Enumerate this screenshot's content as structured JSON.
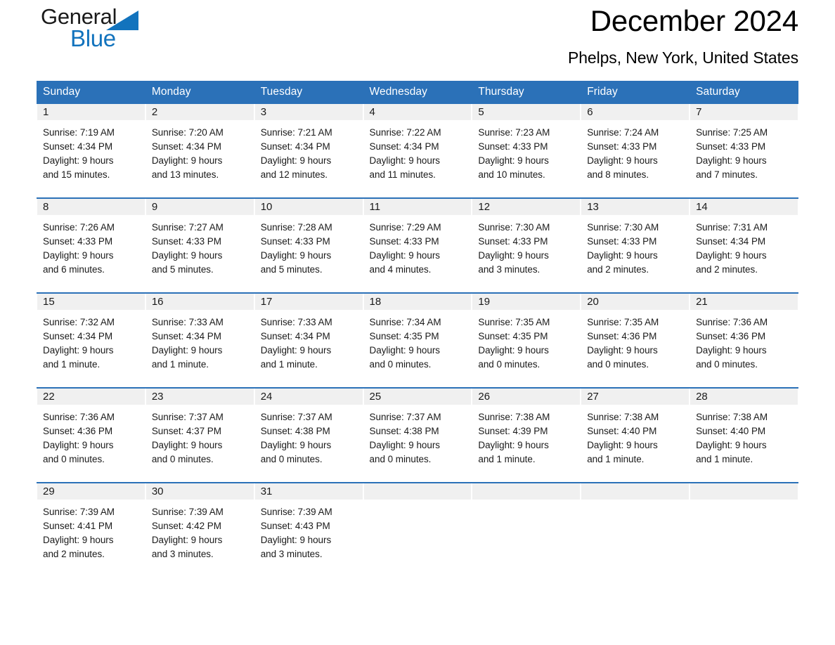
{
  "logo": {
    "word_one": "General",
    "word_two": "Blue",
    "triangle_color": "#1273bd",
    "text_color": "#1a1a1a"
  },
  "header": {
    "title": "December 2024",
    "subtitle": "Phelps, New York, United States"
  },
  "theme": {
    "header_blue": "#2b71b8",
    "daynum_strip": "#f0f0f0",
    "text": "#1a1a1a",
    "page_background": "#ffffff"
  },
  "calendar": {
    "day_headers": [
      "Sunday",
      "Monday",
      "Tuesday",
      "Wednesday",
      "Thursday",
      "Friday",
      "Saturday"
    ],
    "weeks": [
      [
        {
          "day": "1",
          "sunrise": "Sunrise: 7:19 AM",
          "sunset": "Sunset: 4:34 PM",
          "daylight_line1": "Daylight: 9 hours",
          "daylight_line2": "and 15 minutes."
        },
        {
          "day": "2",
          "sunrise": "Sunrise: 7:20 AM",
          "sunset": "Sunset: 4:34 PM",
          "daylight_line1": "Daylight: 9 hours",
          "daylight_line2": "and 13 minutes."
        },
        {
          "day": "3",
          "sunrise": "Sunrise: 7:21 AM",
          "sunset": "Sunset: 4:34 PM",
          "daylight_line1": "Daylight: 9 hours",
          "daylight_line2": "and 12 minutes."
        },
        {
          "day": "4",
          "sunrise": "Sunrise: 7:22 AM",
          "sunset": "Sunset: 4:34 PM",
          "daylight_line1": "Daylight: 9 hours",
          "daylight_line2": "and 11 minutes."
        },
        {
          "day": "5",
          "sunrise": "Sunrise: 7:23 AM",
          "sunset": "Sunset: 4:33 PM",
          "daylight_line1": "Daylight: 9 hours",
          "daylight_line2": "and 10 minutes."
        },
        {
          "day": "6",
          "sunrise": "Sunrise: 7:24 AM",
          "sunset": "Sunset: 4:33 PM",
          "daylight_line1": "Daylight: 9 hours",
          "daylight_line2": "and 8 minutes."
        },
        {
          "day": "7",
          "sunrise": "Sunrise: 7:25 AM",
          "sunset": "Sunset: 4:33 PM",
          "daylight_line1": "Daylight: 9 hours",
          "daylight_line2": "and 7 minutes."
        }
      ],
      [
        {
          "day": "8",
          "sunrise": "Sunrise: 7:26 AM",
          "sunset": "Sunset: 4:33 PM",
          "daylight_line1": "Daylight: 9 hours",
          "daylight_line2": "and 6 minutes."
        },
        {
          "day": "9",
          "sunrise": "Sunrise: 7:27 AM",
          "sunset": "Sunset: 4:33 PM",
          "daylight_line1": "Daylight: 9 hours",
          "daylight_line2": "and 5 minutes."
        },
        {
          "day": "10",
          "sunrise": "Sunrise: 7:28 AM",
          "sunset": "Sunset: 4:33 PM",
          "daylight_line1": "Daylight: 9 hours",
          "daylight_line2": "and 5 minutes."
        },
        {
          "day": "11",
          "sunrise": "Sunrise: 7:29 AM",
          "sunset": "Sunset: 4:33 PM",
          "daylight_line1": "Daylight: 9 hours",
          "daylight_line2": "and 4 minutes."
        },
        {
          "day": "12",
          "sunrise": "Sunrise: 7:30 AM",
          "sunset": "Sunset: 4:33 PM",
          "daylight_line1": "Daylight: 9 hours",
          "daylight_line2": "and 3 minutes."
        },
        {
          "day": "13",
          "sunrise": "Sunrise: 7:30 AM",
          "sunset": "Sunset: 4:33 PM",
          "daylight_line1": "Daylight: 9 hours",
          "daylight_line2": "and 2 minutes."
        },
        {
          "day": "14",
          "sunrise": "Sunrise: 7:31 AM",
          "sunset": "Sunset: 4:34 PM",
          "daylight_line1": "Daylight: 9 hours",
          "daylight_line2": "and 2 minutes."
        }
      ],
      [
        {
          "day": "15",
          "sunrise": "Sunrise: 7:32 AM",
          "sunset": "Sunset: 4:34 PM",
          "daylight_line1": "Daylight: 9 hours",
          "daylight_line2": "and 1 minute."
        },
        {
          "day": "16",
          "sunrise": "Sunrise: 7:33 AM",
          "sunset": "Sunset: 4:34 PM",
          "daylight_line1": "Daylight: 9 hours",
          "daylight_line2": "and 1 minute."
        },
        {
          "day": "17",
          "sunrise": "Sunrise: 7:33 AM",
          "sunset": "Sunset: 4:34 PM",
          "daylight_line1": "Daylight: 9 hours",
          "daylight_line2": "and 1 minute."
        },
        {
          "day": "18",
          "sunrise": "Sunrise: 7:34 AM",
          "sunset": "Sunset: 4:35 PM",
          "daylight_line1": "Daylight: 9 hours",
          "daylight_line2": "and 0 minutes."
        },
        {
          "day": "19",
          "sunrise": "Sunrise: 7:35 AM",
          "sunset": "Sunset: 4:35 PM",
          "daylight_line1": "Daylight: 9 hours",
          "daylight_line2": "and 0 minutes."
        },
        {
          "day": "20",
          "sunrise": "Sunrise: 7:35 AM",
          "sunset": "Sunset: 4:36 PM",
          "daylight_line1": "Daylight: 9 hours",
          "daylight_line2": "and 0 minutes."
        },
        {
          "day": "21",
          "sunrise": "Sunrise: 7:36 AM",
          "sunset": "Sunset: 4:36 PM",
          "daylight_line1": "Daylight: 9 hours",
          "daylight_line2": "and 0 minutes."
        }
      ],
      [
        {
          "day": "22",
          "sunrise": "Sunrise: 7:36 AM",
          "sunset": "Sunset: 4:36 PM",
          "daylight_line1": "Daylight: 9 hours",
          "daylight_line2": "and 0 minutes."
        },
        {
          "day": "23",
          "sunrise": "Sunrise: 7:37 AM",
          "sunset": "Sunset: 4:37 PM",
          "daylight_line1": "Daylight: 9 hours",
          "daylight_line2": "and 0 minutes."
        },
        {
          "day": "24",
          "sunrise": "Sunrise: 7:37 AM",
          "sunset": "Sunset: 4:38 PM",
          "daylight_line1": "Daylight: 9 hours",
          "daylight_line2": "and 0 minutes."
        },
        {
          "day": "25",
          "sunrise": "Sunrise: 7:37 AM",
          "sunset": "Sunset: 4:38 PM",
          "daylight_line1": "Daylight: 9 hours",
          "daylight_line2": "and 0 minutes."
        },
        {
          "day": "26",
          "sunrise": "Sunrise: 7:38 AM",
          "sunset": "Sunset: 4:39 PM",
          "daylight_line1": "Daylight: 9 hours",
          "daylight_line2": "and 1 minute."
        },
        {
          "day": "27",
          "sunrise": "Sunrise: 7:38 AM",
          "sunset": "Sunset: 4:40 PM",
          "daylight_line1": "Daylight: 9 hours",
          "daylight_line2": "and 1 minute."
        },
        {
          "day": "28",
          "sunrise": "Sunrise: 7:38 AM",
          "sunset": "Sunset: 4:40 PM",
          "daylight_line1": "Daylight: 9 hours",
          "daylight_line2": "and 1 minute."
        }
      ],
      [
        {
          "day": "29",
          "sunrise": "Sunrise: 7:39 AM",
          "sunset": "Sunset: 4:41 PM",
          "daylight_line1": "Daylight: 9 hours",
          "daylight_line2": "and 2 minutes."
        },
        {
          "day": "30",
          "sunrise": "Sunrise: 7:39 AM",
          "sunset": "Sunset: 4:42 PM",
          "daylight_line1": "Daylight: 9 hours",
          "daylight_line2": "and 3 minutes."
        },
        {
          "day": "31",
          "sunrise": "Sunrise: 7:39 AM",
          "sunset": "Sunset: 4:43 PM",
          "daylight_line1": "Daylight: 9 hours",
          "daylight_line2": "and 3 minutes."
        },
        {
          "day": "",
          "sunrise": "",
          "sunset": "",
          "daylight_line1": "",
          "daylight_line2": ""
        },
        {
          "day": "",
          "sunrise": "",
          "sunset": "",
          "daylight_line1": "",
          "daylight_line2": ""
        },
        {
          "day": "",
          "sunrise": "",
          "sunset": "",
          "daylight_line1": "",
          "daylight_line2": ""
        },
        {
          "day": "",
          "sunrise": "",
          "sunset": "",
          "daylight_line1": "",
          "daylight_line2": ""
        }
      ]
    ]
  }
}
